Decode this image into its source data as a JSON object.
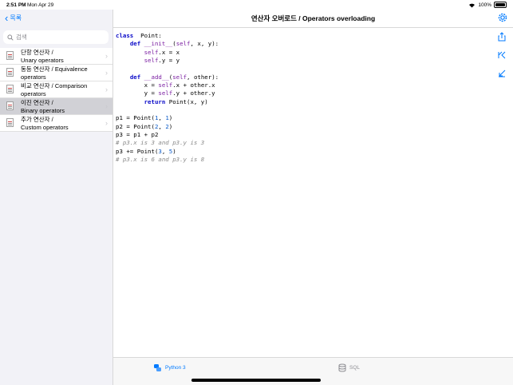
{
  "status": {
    "time": "2:51 PM",
    "date": "Mon Apr 29",
    "battery": "100%"
  },
  "sidebar": {
    "back_label": "목록",
    "search_placeholder": "검색",
    "items": [
      {
        "line1": "단항 연산자 /",
        "line2": "Unary operators",
        "selected": false
      },
      {
        "line1": "동등 연산자 / Equivalence",
        "line2": "operators",
        "selected": false
      },
      {
        "line1": "비교 연산자 / Comparison",
        "line2": "operators",
        "selected": false
      },
      {
        "line1": "이진 연산자 /",
        "line2": "Binary operators",
        "selected": true
      },
      {
        "line1": "추가 연산자 /",
        "line2": "Custom operators",
        "selected": false
      }
    ]
  },
  "main": {
    "title": "연산자 오버로드 / Operators overloading",
    "code": [
      [
        [
          "kw",
          "class"
        ],
        [
          "",
          "  Point:"
        ]
      ],
      [
        [
          "",
          "    "
        ],
        [
          "kw",
          "def"
        ],
        [
          "",
          " "
        ],
        [
          "sp",
          "__init__"
        ],
        [
          "",
          "("
        ],
        [
          "sf",
          "self"
        ],
        [
          "",
          ", x, y):"
        ]
      ],
      [
        [
          "",
          "        "
        ],
        [
          "sf",
          "self"
        ],
        [
          "",
          ".x = x"
        ]
      ],
      [
        [
          "",
          "        "
        ],
        [
          "sf",
          "self"
        ],
        [
          "",
          ".y = y"
        ]
      ],
      [
        [
          "",
          ""
        ]
      ],
      [
        [
          "",
          "    "
        ],
        [
          "kw",
          "def"
        ],
        [
          "",
          " "
        ],
        [
          "sp",
          "__add__"
        ],
        [
          "",
          "("
        ],
        [
          "sf",
          "self"
        ],
        [
          "",
          ", other):"
        ]
      ],
      [
        [
          "",
          "        x = "
        ],
        [
          "sf",
          "self"
        ],
        [
          "",
          ".x + other.x"
        ]
      ],
      [
        [
          "",
          "        y = "
        ],
        [
          "sf",
          "self"
        ],
        [
          "",
          ".y + other.y"
        ]
      ],
      [
        [
          "",
          "        "
        ],
        [
          "kw",
          "return"
        ],
        [
          "",
          " Point(x, y)"
        ]
      ],
      [
        [
          "",
          ""
        ]
      ],
      [
        [
          "",
          "p1 = Point("
        ],
        [
          "num",
          "1"
        ],
        [
          "",
          ", "
        ],
        [
          "num",
          "1"
        ],
        [
          "",
          ")"
        ]
      ],
      [
        [
          "",
          "p2 = Point("
        ],
        [
          "num",
          "2"
        ],
        [
          "",
          ", "
        ],
        [
          "num",
          "2"
        ],
        [
          "",
          ")"
        ]
      ],
      [
        [
          "",
          "p3 = p1 + p2"
        ]
      ],
      [
        [
          "cm",
          "# p3.x is 3 and p3.y is 3"
        ]
      ],
      [
        [
          "",
          "p3 += Point("
        ],
        [
          "num",
          "3"
        ],
        [
          "",
          ", "
        ],
        [
          "num",
          "5"
        ],
        [
          "",
          ")"
        ]
      ],
      [
        [
          "cm",
          "# p3.x is 6 and p3.y is 8"
        ]
      ]
    ]
  },
  "tabs": [
    {
      "label": "Python 3",
      "active": true
    },
    {
      "label": "SQL",
      "active": false
    }
  ],
  "colors": {
    "accent": "#007aff"
  }
}
